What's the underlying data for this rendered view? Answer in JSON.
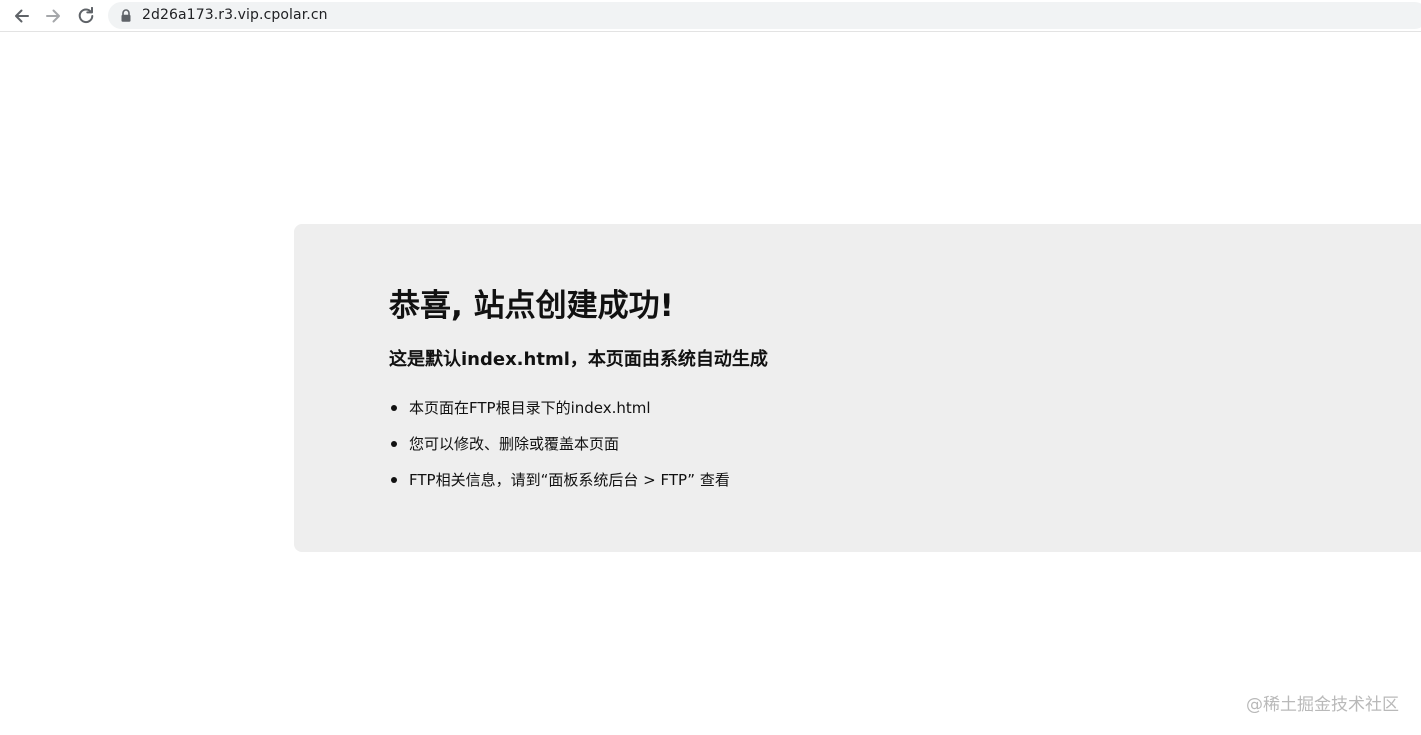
{
  "browser": {
    "url": "2d26a173.r3.vip.cpolar.cn"
  },
  "page": {
    "title": "恭喜, 站点创建成功!",
    "subtitle": "这是默认index.html，本页面由系统自动生成",
    "items": [
      "本页面在FTP根目录下的index.html",
      "您可以修改、删除或覆盖本页面",
      "FTP相关信息，请到“面板系统后台 > FTP” 查看"
    ]
  },
  "watermark": "@稀土掘金技术社区",
  "colors": {
    "card_background": "#eeeeee",
    "omnibox_background": "#f1f3f4",
    "text": "#111111",
    "watermark": "#b9b9b9"
  },
  "icons": [
    "back-arrow-icon",
    "forward-arrow-icon",
    "reload-icon",
    "lock-icon"
  ]
}
